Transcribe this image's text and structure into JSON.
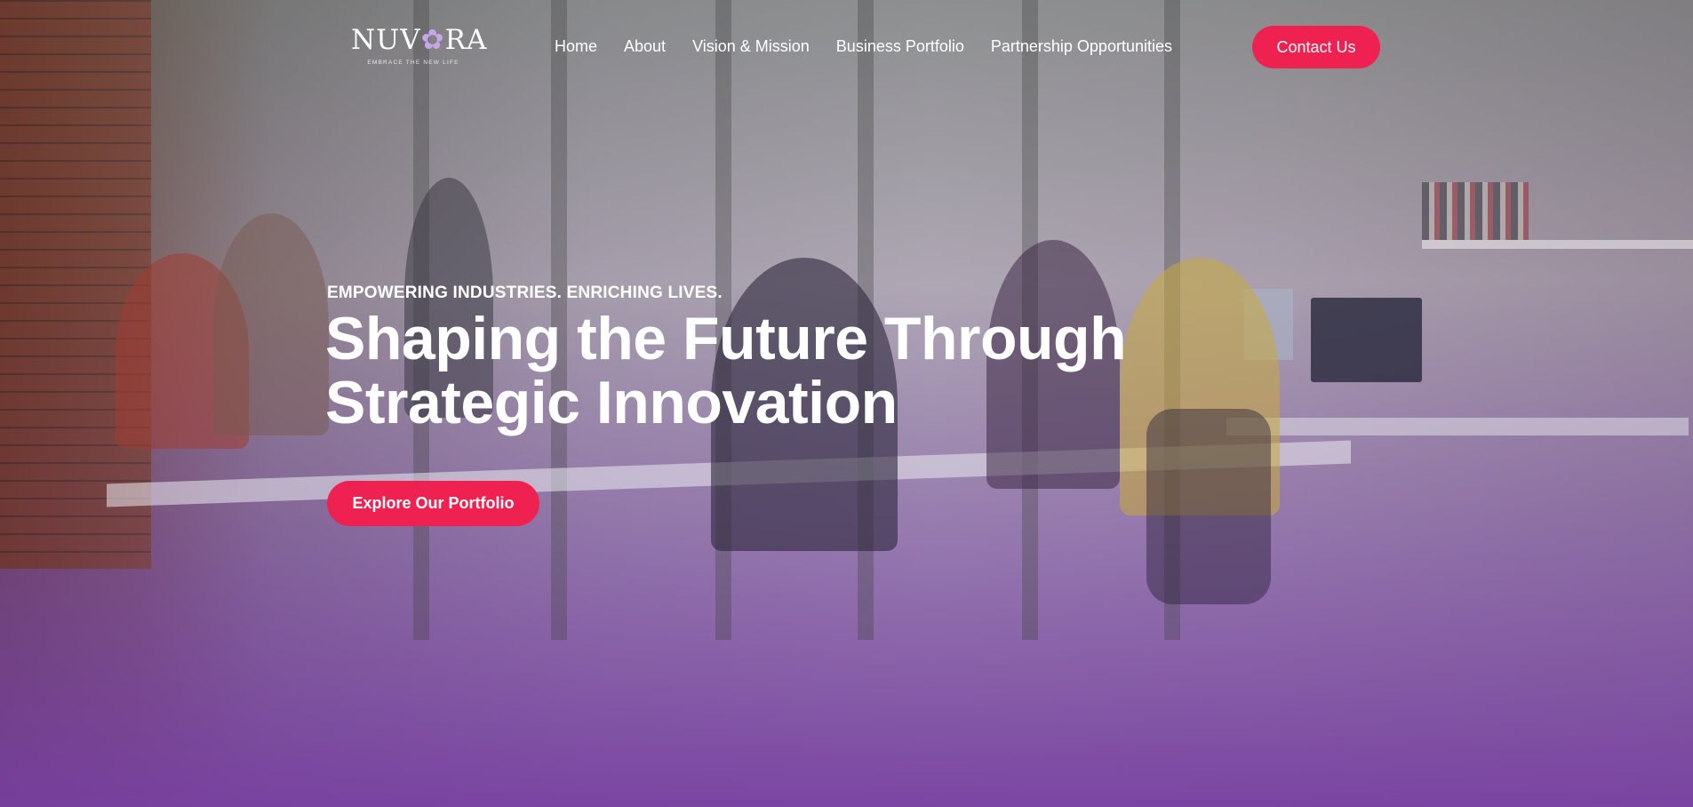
{
  "brand": {
    "name_part1": "NUV",
    "name_mark": "✿",
    "name_part2": "RA",
    "tagline": "EMBRACE THE NEW LIFE",
    "accent_color": "#ee2150",
    "theme_color": "#7a40a8"
  },
  "nav": {
    "items": [
      {
        "label": "Home"
      },
      {
        "label": "About"
      },
      {
        "label": "Vision & Mission"
      },
      {
        "label": "Business Portfolio"
      },
      {
        "label": "Partnership Opportunities"
      }
    ],
    "contact_label": "Contact Us"
  },
  "hero": {
    "eyebrow": "EMPOWERING INDUSTRIES. ENRICHING LIVES.",
    "headline_line1": "Shaping the Future Through",
    "headline_line2": "Strategic Innovation",
    "cta_label": "Explore Our Portfolio",
    "background_image": "office-team-photo"
  }
}
